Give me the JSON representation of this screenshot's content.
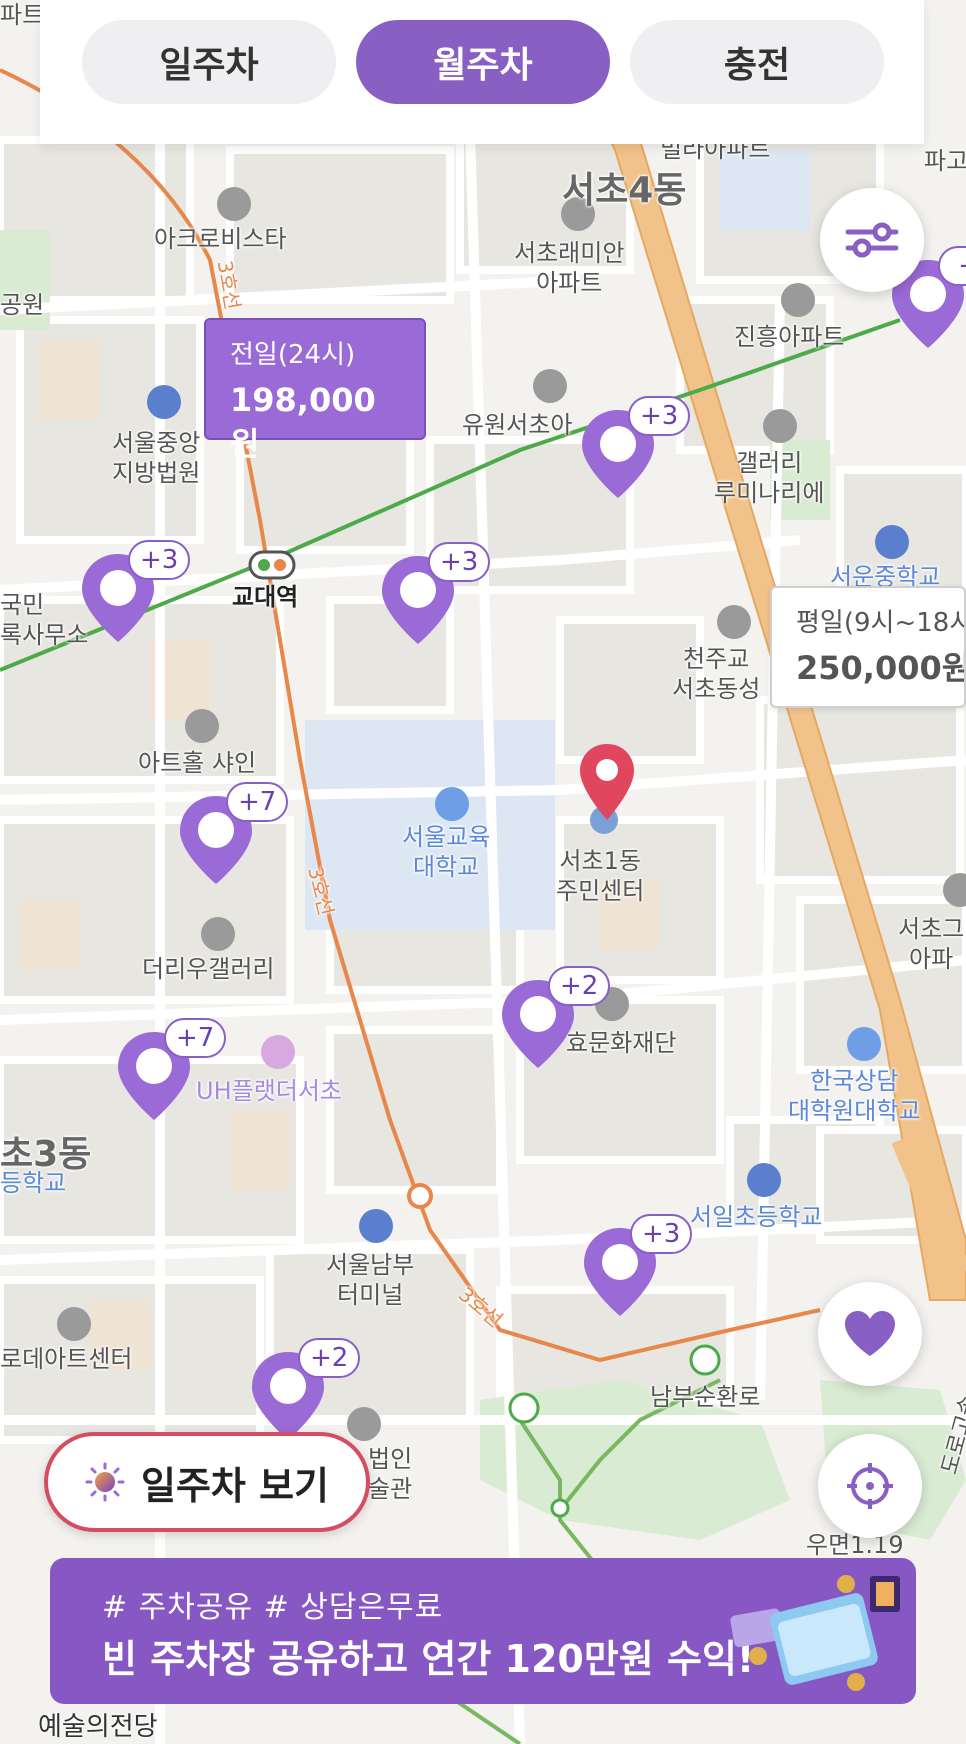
{
  "tabs": [
    {
      "label": "일주차",
      "active": false
    },
    {
      "label": "월주차",
      "active": true
    },
    {
      "label": "충전",
      "active": false
    }
  ],
  "price_tags": [
    {
      "label": "전일(24시)",
      "price": "198,000원",
      "style": "selected"
    },
    {
      "label": "평일(9시~18시",
      "price": "250,000원",
      "style": "default"
    }
  ],
  "pins": [
    {
      "badge": "+"
    },
    {
      "badge": "+3"
    },
    {
      "badge": "+3"
    },
    {
      "badge": "+3"
    },
    {
      "badge": "+7"
    },
    {
      "badge": "+2"
    },
    {
      "badge": "+7"
    },
    {
      "badge": "+3"
    },
    {
      "badge": "+2"
    }
  ],
  "map_labels": {
    "apt_top_left": "파트",
    "apt_top": "빌라아파트",
    "park_top_right": "파고",
    "seocho4dong": "서초4동",
    "acrovista": "아크로비스타",
    "raemian": "서초래미안\n아파트",
    "jinheung": "진흥아파트",
    "park_left": "공원",
    "court": "서울중앙\n지방법원",
    "yuwon": "유원서초아",
    "gallery_lumi": "갤러리\n루미나리에",
    "registry": "국민\n록사무소",
    "gyodae_station": "교대역",
    "seoul_middle": "서운중학교",
    "catholic": "천주교\n서초동성",
    "art_hall": "아트홀 샤인",
    "seoul_edu_univ": "서울교육\n대학교",
    "seocho1dong_center": "서초1동\n주민센터",
    "seocho_right": "서초그\n아파",
    "deriu_gallery": "더리우갤러리",
    "culture_foundation": "효문화재단",
    "uh_flat": "UH플랫더서초",
    "korea_grad": "한국상담\n대학원대학교",
    "seocho3dong": "초3동",
    "school_left": "등학교",
    "line3_a": "3호선",
    "line3_b": "3호선",
    "line3_c": "3호선",
    "seoil_elem": "서일초등학교",
    "nambu_terminal": "서울남부\n터미널",
    "arts_center": "로데아트센터",
    "nambu_ring": "남부순환로",
    "law_art": "법인\n술관",
    "expressway": "도로고속",
    "post_office": "우면1.19"
  },
  "daily_toggle": {
    "label": "일주차 보기"
  },
  "banner": {
    "tags": "# 주차공유  # 상담은무료",
    "headline": "빈 주차장 공유하고 연간 120만원 수익!"
  },
  "bottom_label": "예술의전당",
  "buttons": {
    "filter_icon": "sliders-icon",
    "favorite_icon": "heart-icon",
    "locate_icon": "crosshair-icon"
  },
  "colors": {
    "brand_purple": "#8a5fc4",
    "pin_purple": "#9a6ad6",
    "current_location_red": "#e0475f",
    "subway_line2_green": "#4caa48",
    "subway_line3_orange": "#e8874a",
    "main_road": "#f1c28a"
  }
}
